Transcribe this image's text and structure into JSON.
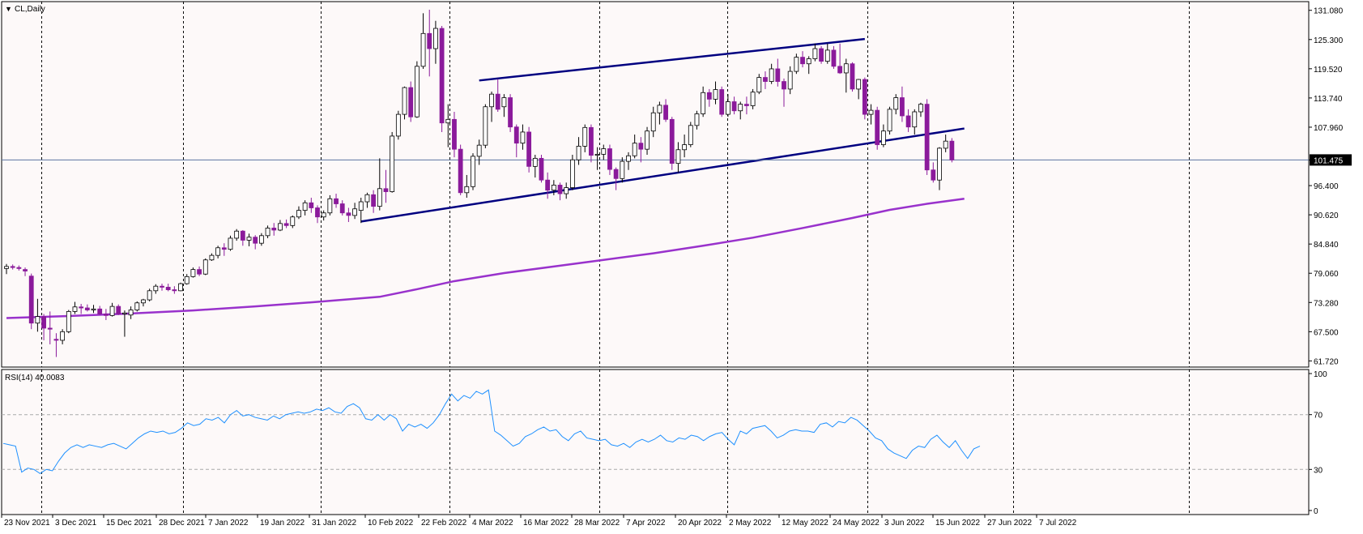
{
  "symbol_label": "CL,Daily",
  "menu_icon": "triangle-down-icon",
  "current_price": "101.475",
  "colors": {
    "background": "#ffffff",
    "panel": "#fdf9f9",
    "frame": "#000000",
    "bull_body": "#ffffff",
    "bull_border": "#000000",
    "bear_body": "#8b1a9b",
    "bear_border": "#8b1a9b",
    "ma_line": "#9932cc",
    "channel_line": "#000080",
    "price_line": "#5b76a0",
    "rsi_line": "#1e90ff",
    "grid_dash": "#000000",
    "rsi_level": "#aaaaaa"
  },
  "chart_data": [
    {
      "type": "candlestick",
      "title": "CL,Daily",
      "y_axis_labels": [
        "131.080",
        "125.300",
        "119.520",
        "113.740",
        "107.960",
        "101.475",
        "96.400",
        "90.620",
        "84.840",
        "79.060",
        "73.280",
        "67.500",
        "61.720"
      ],
      "ylim": [
        60.5,
        132.8
      ],
      "x_axis_labels": [
        "23 Nov 2021",
        "3 Dec 2021",
        "15 Dec 2021",
        "28 Dec 2021",
        "7 Jan 2022",
        "19 Jan 2022",
        "31 Jan 2022",
        "10 Feb 2022",
        "22 Feb 2022",
        "4 Mar 2022",
        "16 Mar 2022",
        "28 Mar 2022",
        "7 Apr 2022",
        "20 Apr 2022",
        "2 May 2022",
        "12 May 2022",
        "24 May 2022",
        "3 Jun 2022",
        "15 Jun 2022",
        "27 Jun 2022",
        "7 Jul 2022"
      ],
      "grid": "vertical dashed",
      "last_price": 101.475,
      "candles": [
        [
          80.0,
          80.9,
          78.9,
          80.4
        ],
        [
          80.4,
          80.8,
          79.8,
          80.2
        ],
        [
          80.2,
          80.6,
          79.6,
          80.0
        ],
        [
          79.8,
          80.2,
          78.5,
          79.5
        ],
        [
          78.5,
          79.0,
          68.0,
          69.2
        ],
        [
          69.2,
          74.0,
          67.5,
          70.5
        ],
        [
          70.5,
          71.0,
          65.8,
          68.2
        ],
        [
          68.2,
          71.5,
          65.0,
          68.0
        ],
        [
          66.0,
          67.2,
          62.5,
          65.8
        ],
        [
          65.8,
          68.0,
          65.0,
          67.5
        ],
        [
          67.5,
          71.8,
          67.2,
          71.5
        ],
        [
          71.5,
          73.4,
          71.0,
          72.4
        ],
        [
          72.4,
          73.0,
          71.0,
          72.2
        ],
        [
          72.2,
          72.9,
          71.5,
          71.8
        ],
        [
          71.8,
          72.8,
          71.2,
          72.0
        ],
        [
          72.0,
          72.6,
          70.8,
          71.0
        ],
        [
          71.0,
          72.0,
          69.8,
          70.7
        ],
        [
          70.7,
          73.2,
          70.5,
          72.5
        ],
        [
          72.5,
          72.9,
          70.8,
          71.0
        ],
        [
          71.0,
          71.7,
          66.5,
          71.2
        ],
        [
          70.8,
          72.5,
          70.0,
          71.8
        ],
        [
          71.8,
          73.5,
          71.5,
          73.2
        ],
        [
          73.2,
          74.0,
          72.5,
          73.8
        ],
        [
          73.8,
          76.0,
          73.5,
          75.6
        ],
        [
          75.6,
          76.9,
          75.0,
          76.5
        ],
        [
          76.5,
          77.0,
          75.6,
          76.3
        ],
        [
          76.3,
          77.0,
          75.5,
          75.8
        ],
        [
          75.8,
          76.5,
          75.0,
          75.6
        ],
        [
          75.6,
          77.2,
          75.5,
          77.0
        ],
        [
          77.0,
          78.9,
          76.8,
          78.4
        ],
        [
          78.4,
          80.2,
          78.2,
          79.8
        ],
        [
          79.8,
          80.4,
          78.5,
          78.9
        ],
        [
          78.9,
          82.0,
          78.7,
          81.7
        ],
        [
          81.7,
          83.0,
          81.5,
          82.6
        ],
        [
          82.6,
          84.5,
          82.0,
          84.1
        ],
        [
          84.1,
          85.0,
          82.5,
          83.8
        ],
        [
          83.8,
          86.5,
          83.5,
          86.0
        ],
        [
          86.0,
          87.8,
          85.5,
          87.4
        ],
        [
          87.4,
          87.6,
          84.5,
          85.6
        ],
        [
          85.6,
          86.9,
          84.4,
          86.2
        ],
        [
          86.2,
          86.6,
          83.8,
          85.0
        ],
        [
          85.0,
          87.0,
          84.5,
          86.5
        ],
        [
          86.5,
          88.5,
          86.0,
          88.0
        ],
        [
          88.0,
          89.0,
          86.5,
          87.6
        ],
        [
          87.6,
          89.6,
          87.4,
          88.9
        ],
        [
          88.9,
          89.7,
          88.0,
          88.5
        ],
        [
          88.5,
          90.5,
          88.0,
          90.2
        ],
        [
          90.2,
          92.3,
          89.8,
          91.5
        ],
        [
          91.5,
          93.5,
          90.5,
          93.0
        ],
        [
          93.0,
          94.0,
          91.0,
          92.0
        ],
        [
          92.0,
          92.5,
          89.0,
          90.2
        ],
        [
          90.2,
          91.5,
          89.5,
          91.0
        ],
        [
          91.0,
          94.5,
          90.5,
          93.8
        ],
        [
          93.8,
          94.8,
          92.0,
          92.8
        ],
        [
          92.8,
          93.5,
          90.5,
          91.0
        ],
        [
          91.0,
          92.0,
          89.2,
          90.5
        ],
        [
          90.5,
          93.0,
          89.8,
          91.8
        ],
        [
          91.5,
          94.0,
          89.0,
          93.2
        ],
        [
          93.2,
          95.0,
          92.0,
          94.6
        ],
        [
          94.6,
          95.5,
          91.0,
          92.3
        ],
        [
          92.3,
          101.8,
          91.5,
          95.8
        ],
        [
          95.8,
          99.5,
          93.0,
          95.2
        ],
        [
          95.2,
          107.0,
          95.0,
          106.2
        ],
        [
          106.2,
          111.2,
          105.5,
          110.5
        ],
        [
          110.5,
          116.0,
          109.5,
          115.8
        ],
        [
          115.8,
          117.0,
          109.0,
          110.0
        ],
        [
          110.0,
          121.0,
          109.8,
          120.0
        ],
        [
          120.0,
          130.5,
          119.5,
          126.5
        ],
        [
          126.5,
          131.2,
          118.0,
          123.5
        ],
        [
          123.5,
          129.0,
          120.5,
          127.5
        ],
        [
          127.5,
          128.0,
          107.0,
          108.8
        ],
        [
          108.8,
          112.5,
          104.0,
          109.5
        ],
        [
          109.5,
          111.0,
          102.0,
          103.6
        ],
        [
          103.6,
          104.5,
          94.5,
          95.0
        ],
        [
          95.0,
          98.5,
          94.0,
          96.2
        ],
        [
          96.2,
          102.8,
          95.5,
          102.2
        ],
        [
          102.2,
          105.5,
          100.5,
          104.4
        ],
        [
          104.4,
          112.5,
          103.8,
          112.0
        ],
        [
          112.0,
          115.0,
          109.0,
          114.5
        ],
        [
          114.5,
          117.5,
          111.0,
          111.5
        ],
        [
          112.0,
          114.5,
          110.0,
          113.8
        ],
        [
          113.8,
          114.5,
          107.0,
          108.0
        ],
        [
          108.0,
          108.5,
          102.0,
          104.8
        ],
        [
          104.8,
          108.5,
          103.5,
          107.0
        ],
        [
          107.0,
          108.0,
          99.0,
          100.2
        ],
        [
          100.2,
          102.5,
          98.0,
          101.8
        ],
        [
          101.8,
          102.5,
          97.0,
          97.5
        ],
        [
          97.5,
          99.0,
          93.8,
          95.5
        ],
        [
          95.5,
          97.5,
          94.5,
          96.5
        ],
        [
          96.5,
          97.0,
          93.5,
          94.8
        ],
        [
          94.8,
          97.0,
          93.8,
          96.0
        ],
        [
          96.0,
          102.5,
          95.5,
          101.5
        ],
        [
          101.5,
          106.0,
          100.5,
          104.2
        ],
        [
          104.2,
          108.5,
          103.0,
          107.9
        ],
        [
          107.9,
          108.5,
          101.0,
          102.4
        ],
        [
          102.4,
          104.0,
          99.5,
          102.6
        ],
        [
          102.6,
          104.5,
          101.5,
          103.7
        ],
        [
          103.7,
          104.5,
          98.5,
          99.6
        ],
        [
          99.6,
          100.0,
          95.5,
          97.8
        ],
        [
          97.8,
          102.0,
          97.0,
          101.2
        ],
        [
          101.2,
          103.0,
          99.5,
          102.3
        ],
        [
          102.3,
          106.5,
          101.8,
          104.8
        ],
        [
          104.8,
          106.0,
          101.0,
          103.6
        ],
        [
          103.6,
          108.0,
          102.5,
          107.2
        ],
        [
          107.2,
          112.0,
          106.0,
          110.8
        ],
        [
          110.8,
          113.0,
          108.5,
          112.3
        ],
        [
          112.3,
          113.5,
          109.0,
          109.5
        ],
        [
          109.5,
          110.0,
          99.5,
          100.8
        ],
        [
          100.8,
          105.0,
          99.0,
          103.5
        ],
        [
          103.5,
          106.5,
          102.0,
          104.5
        ],
        [
          104.5,
          109.0,
          104.0,
          108.3
        ],
        [
          108.3,
          111.2,
          107.5,
          110.6
        ],
        [
          110.6,
          116.0,
          110.0,
          114.8
        ],
        [
          114.8,
          115.5,
          112.0,
          113.5
        ],
        [
          113.5,
          117.0,
          112.5,
          115.4
        ],
        [
          115.4,
          116.0,
          110.0,
          110.5
        ],
        [
          110.5,
          114.5,
          110.0,
          113.0
        ],
        [
          113.0,
          114.0,
          110.5,
          111.2
        ],
        [
          111.2,
          113.0,
          109.5,
          112.5
        ],
        [
          112.5,
          114.0,
          110.5,
          112.2
        ],
        [
          112.2,
          115.5,
          111.5,
          114.9
        ],
        [
          114.9,
          118.5,
          114.5,
          117.8
        ],
        [
          117.8,
          119.0,
          115.5,
          117.0
        ],
        [
          117.0,
          120.5,
          116.5,
          119.5
        ],
        [
          119.5,
          121.5,
          116.0,
          117.0
        ],
        [
          117.0,
          117.6,
          112.0,
          115.5
        ],
        [
          115.5,
          120.0,
          114.5,
          119.0
        ],
        [
          119.0,
          122.5,
          118.5,
          121.8
        ],
        [
          121.8,
          123.0,
          119.8,
          120.5
        ],
        [
          120.5,
          122.0,
          118.5,
          121.5
        ],
        [
          121.5,
          124.5,
          121.0,
          123.5
        ],
        [
          123.5,
          124.0,
          120.5,
          121.0
        ],
        [
          121.0,
          124.5,
          120.5,
          123.2
        ],
        [
          123.2,
          124.0,
          119.5,
          120.0
        ],
        [
          120.0,
          124.5,
          118.5,
          118.7
        ],
        [
          118.7,
          121.5,
          114.8,
          120.5
        ],
        [
          120.5,
          120.8,
          115.0,
          115.5
        ],
        [
          115.5,
          117.5,
          113.5,
          117.4
        ],
        [
          117.4,
          117.8,
          109.5,
          110.5
        ],
        [
          110.5,
          112.5,
          108.5,
          111.3
        ],
        [
          111.3,
          112.0,
          103.5,
          104.5
        ],
        [
          104.5,
          108.5,
          104.0,
          107.2
        ],
        [
          107.2,
          112.0,
          106.5,
          111.5
        ],
        [
          111.5,
          114.5,
          110.5,
          113.8
        ],
        [
          113.8,
          116.0,
          109.0,
          110.2
        ],
        [
          110.2,
          111.5,
          107.0,
          108.0
        ],
        [
          108.0,
          111.5,
          106.5,
          111.0
        ],
        [
          111.0,
          112.8,
          110.0,
          112.5
        ],
        [
          112.5,
          113.5,
          98.5,
          99.5
        ],
        [
          99.5,
          101.0,
          97.0,
          97.5
        ],
        [
          97.5,
          104.0,
          95.5,
          103.8
        ],
        [
          103.8,
          106.5,
          103.0,
          105.2
        ],
        [
          105.2,
          105.8,
          101.0,
          101.475
        ]
      ],
      "ma_points": [
        [
          70.2,
          0
        ],
        [
          70.6,
          10
        ],
        [
          71.1,
          20
        ],
        [
          71.7,
          30
        ],
        [
          72.5,
          40
        ],
        [
          73.4,
          50
        ],
        [
          74.4,
          60
        ],
        [
          75.9,
          66
        ],
        [
          77.5,
          72
        ],
        [
          79.1,
          80
        ],
        [
          80.4,
          88
        ],
        [
          81.7,
          96
        ],
        [
          83.0,
          104
        ],
        [
          84.5,
          112
        ],
        [
          86.1,
          120
        ],
        [
          88.0,
          128
        ],
        [
          90.0,
          136
        ],
        [
          91.6,
          142
        ],
        [
          92.8,
          148
        ],
        [
          93.8,
          154
        ]
      ],
      "channel": {
        "lower": [
          [
            57,
            89.3
          ],
          [
            154,
            107.7
          ]
        ],
        "upper": [
          [
            76,
            117.2
          ],
          [
            138,
            125.4
          ]
        ]
      }
    },
    {
      "type": "line",
      "title": "RSI(14) 40.0083",
      "y_axis_labels": [
        "100",
        "70",
        "30",
        "0"
      ],
      "levels": [
        70,
        30
      ],
      "ylim": [
        0,
        100
      ],
      "values": [
        49,
        48,
        47,
        28,
        31,
        30,
        27,
        30,
        29,
        36,
        42,
        46,
        48,
        46,
        48,
        47,
        46,
        48,
        49,
        47,
        45,
        49,
        53,
        56,
        58,
        57,
        58,
        56,
        57,
        60,
        64,
        62,
        63,
        67,
        66,
        68,
        64,
        70,
        73,
        69,
        70,
        68,
        67,
        66,
        69,
        67,
        70,
        71,
        72,
        71,
        72,
        74,
        73,
        75,
        72,
        71,
        76,
        78,
        75,
        67,
        66,
        70,
        66,
        70,
        67,
        58,
        63,
        61,
        63,
        60,
        64,
        70,
        78,
        85,
        80,
        84,
        82,
        87,
        85,
        88,
        58,
        55,
        51,
        47,
        49,
        54,
        56,
        59,
        61,
        58,
        59,
        54,
        51,
        56,
        58,
        53,
        52,
        51,
        52,
        48,
        47,
        49,
        46,
        50,
        52,
        50,
        52,
        55,
        51,
        50,
        53,
        52,
        55,
        54,
        51,
        54,
        56,
        57,
        52,
        48,
        58,
        56,
        60,
        61,
        62,
        58,
        53,
        55,
        58,
        59,
        58,
        58,
        57,
        63,
        64,
        61,
        65,
        64,
        68,
        66,
        62,
        58,
        53,
        51,
        45,
        42,
        40,
        38,
        44,
        47,
        46,
        52,
        55,
        50,
        46,
        51,
        44,
        38,
        45,
        47
      ],
      "last_value": 40.0083
    }
  ]
}
